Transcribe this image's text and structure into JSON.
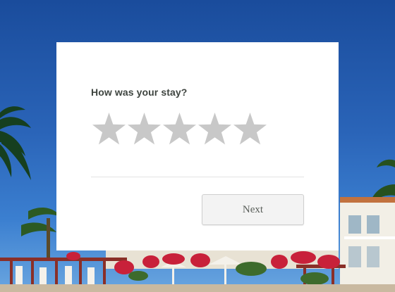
{
  "survey": {
    "question": "How was your stay?",
    "star_count": 5,
    "selected_rating": 0,
    "next_label": "Next"
  },
  "colors": {
    "star_empty": "#c8c8c8",
    "card_background": "#ffffff",
    "button_background": "#f3f3f3",
    "question_text": "#3f4540"
  },
  "icons": {
    "star": "star-icon"
  }
}
